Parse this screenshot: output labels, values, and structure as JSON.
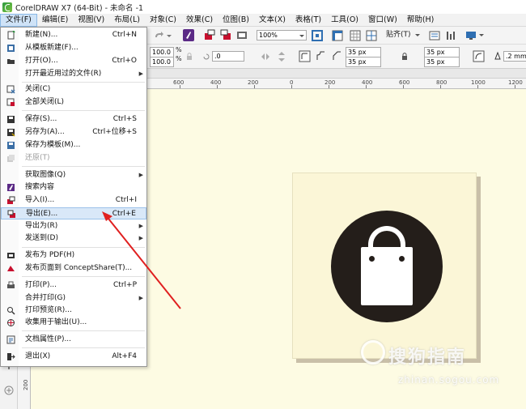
{
  "window": {
    "title": "CorelDRAW X7 (64-Bit) - 未命名 -1"
  },
  "menubar": {
    "items": [
      "文件(F)",
      "编辑(E)",
      "视图(V)",
      "布局(L)",
      "对象(C)",
      "效果(C)",
      "位图(B)",
      "文本(X)",
      "表格(T)",
      "工具(O)",
      "窗口(W)",
      "帮助(H)"
    ]
  },
  "toolbar": {
    "zoom": "100%",
    "snap_label": "贴齐(T)",
    "scale_x": "100.0",
    "scale_y": "100.0",
    "pct": "%",
    "angle": ".0",
    "width1": "35 px",
    "width2": "35 px",
    "width3": "35 px",
    "width4": "35 px",
    "outline": ".2 mm"
  },
  "ruler": {
    "ticks": [
      "600",
      "400",
      "200",
      "0",
      "200",
      "400",
      "600",
      "800",
      "1000",
      "1200"
    ],
    "vertical_tick": "200"
  },
  "file_menu": {
    "items": [
      {
        "label": "新建(N)...",
        "shortcut": "Ctrl+N",
        "icon": "new-document-icon"
      },
      {
        "label": "从模板新建(F)...",
        "shortcut": "",
        "icon": "template-icon"
      },
      {
        "label": "打开(O)...",
        "shortcut": "Ctrl+O",
        "icon": "open-folder-icon"
      },
      {
        "label": "打开最近用过的文件(R)",
        "shortcut": "",
        "icon": ""
      },
      {
        "label": "关闭(C)",
        "shortcut": "",
        "icon": "close-document-icon"
      },
      {
        "label": "全部关闭(L)",
        "shortcut": "",
        "icon": "close-all-icon"
      },
      {
        "label": "保存(S)...",
        "shortcut": "Ctrl+S",
        "icon": "save-icon"
      },
      {
        "label": "另存为(A)...",
        "shortcut": "Ctrl+位移+S",
        "icon": "save-as-icon"
      },
      {
        "label": "保存为模板(M)...",
        "shortcut": "",
        "icon": "save-template-icon"
      },
      {
        "label": "还原(T)",
        "shortcut": "",
        "icon": "revert-icon"
      },
      {
        "label": "获取图像(Q)",
        "shortcut": "",
        "icon": ""
      },
      {
        "label": "搜索内容",
        "shortcut": "",
        "icon": "search-content-icon"
      },
      {
        "label": "导入(I)...",
        "shortcut": "Ctrl+I",
        "icon": "import-icon"
      },
      {
        "label": "导出(E)...",
        "shortcut": "Ctrl+E",
        "icon": "export-icon"
      },
      {
        "label": "导出为(R)",
        "shortcut": "",
        "icon": ""
      },
      {
        "label": "发送到(D)",
        "shortcut": "",
        "icon": ""
      },
      {
        "label": "发布为 PDF(H)",
        "shortcut": "",
        "icon": "pdf-icon"
      },
      {
        "label": "发布页面到 ConceptShare(T)...",
        "shortcut": "",
        "icon": "conceptshare-icon"
      },
      {
        "label": "打印(P)...",
        "shortcut": "Ctrl+P",
        "icon": "print-icon"
      },
      {
        "label": "合并打印(G)",
        "shortcut": "",
        "icon": ""
      },
      {
        "label": "打印预览(R)...",
        "shortcut": "",
        "icon": "print-preview-icon"
      },
      {
        "label": "收集用于输出(U)...",
        "shortcut": "",
        "icon": "collect-output-icon"
      },
      {
        "label": "文档属性(P)...",
        "shortcut": "",
        "icon": "document-properties-icon"
      },
      {
        "label": "退出(X)",
        "shortcut": "Alt+F4",
        "icon": "exit-icon"
      }
    ]
  },
  "watermark": {
    "main": "搜狗指南",
    "sub": "zhinan.sogou.com"
  },
  "colors": {
    "accent": "#cfe3f7",
    "canvas": "#fdfbe3",
    "circle": "#241e1a",
    "arrow": "#e02020"
  }
}
